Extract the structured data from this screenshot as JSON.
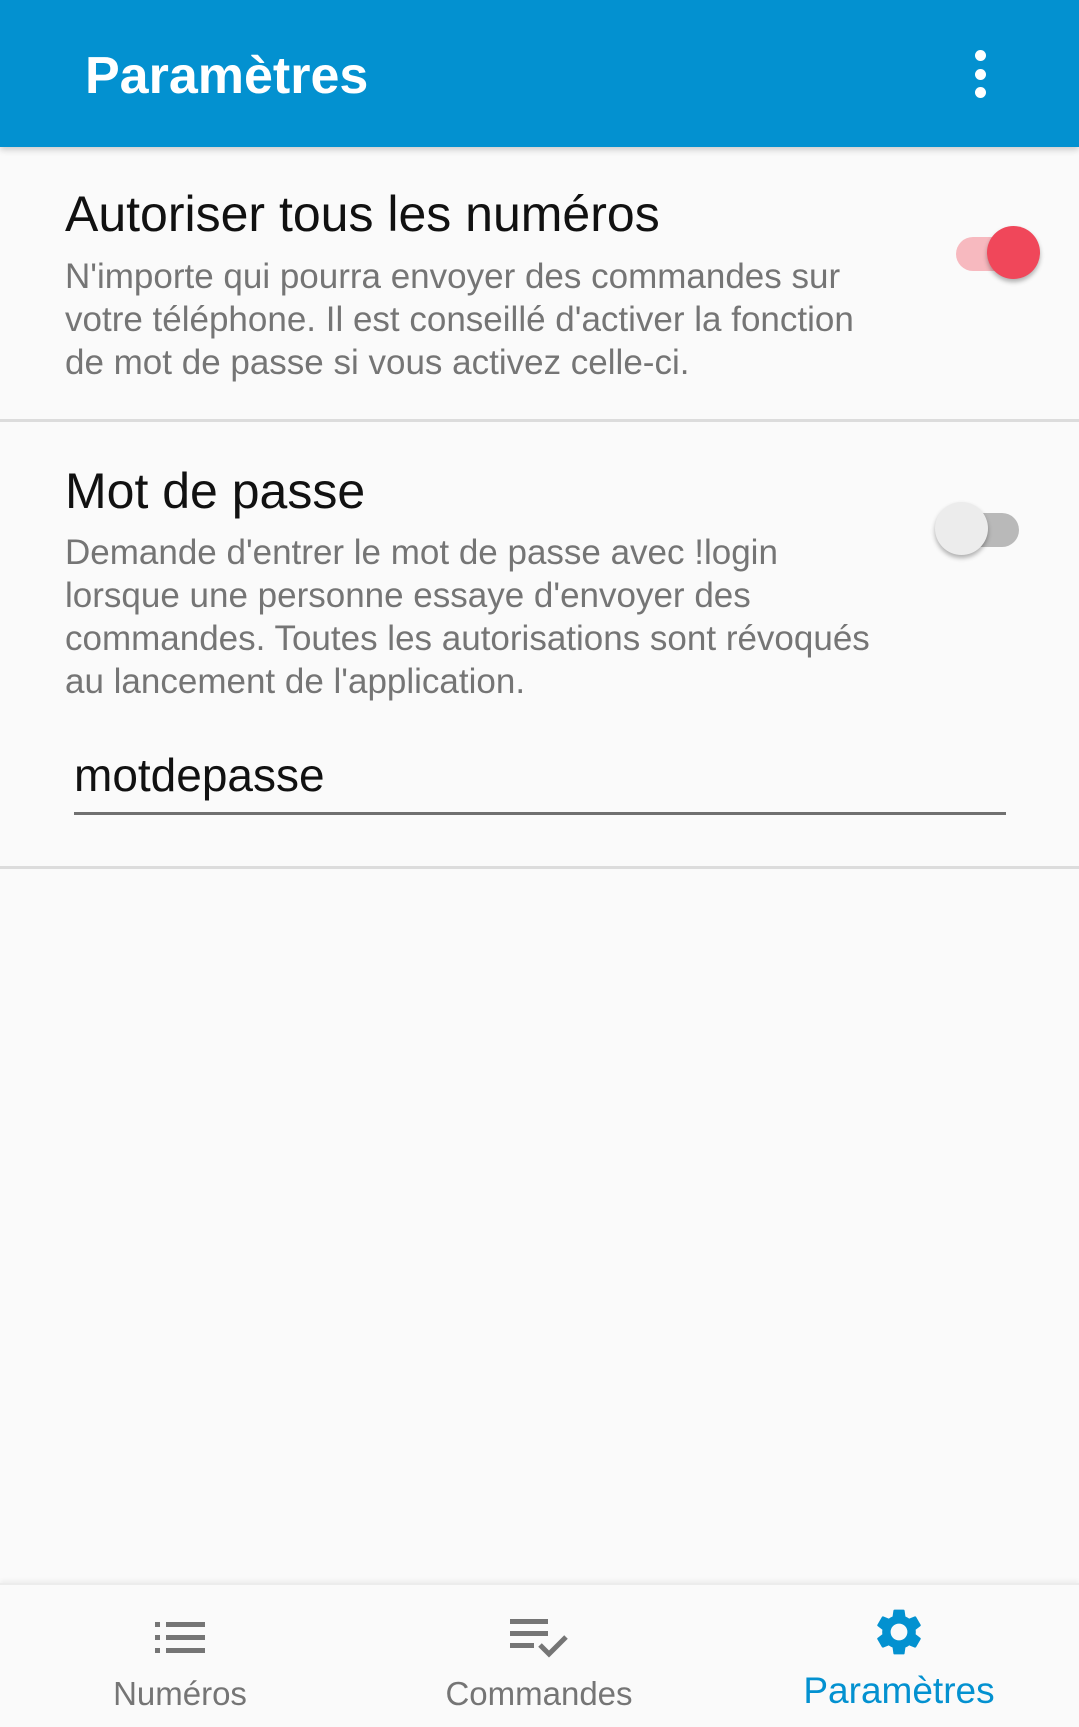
{
  "app_bar": {
    "title": "Paramètres",
    "overflow_icon": "more-vert-icon"
  },
  "colors": {
    "primary": "#0391d0",
    "accent": "#f0475a",
    "accent_track": "#f7b9bf",
    "switch_off_thumb": "#ececec",
    "switch_off_track": "#b9b9b9"
  },
  "preferences": [
    {
      "title": "Autoriser tous les numéros",
      "summary": "N'importe qui pourra envoyer des commandes sur votre téléphone. Il est conseillé d'activer la fonction de mot de passe si vous activez celle-ci.",
      "enabled": true
    },
    {
      "title": "Mot de passe",
      "summary": "Demande d'entrer le mot de passe avec !login lorsque une personne essaye d'envoyer des commandes. Toutes les autorisations sont révoqués au lancement de l'application.",
      "enabled": false,
      "value": "motdepasse"
    }
  ],
  "bottom_nav": {
    "items": [
      {
        "label": "Numéros",
        "icon": "list-icon",
        "active": false
      },
      {
        "label": "Commandes",
        "icon": "playlist-check-icon",
        "active": false
      },
      {
        "label": "Paramètres",
        "icon": "gear-icon",
        "active": true
      }
    ]
  }
}
